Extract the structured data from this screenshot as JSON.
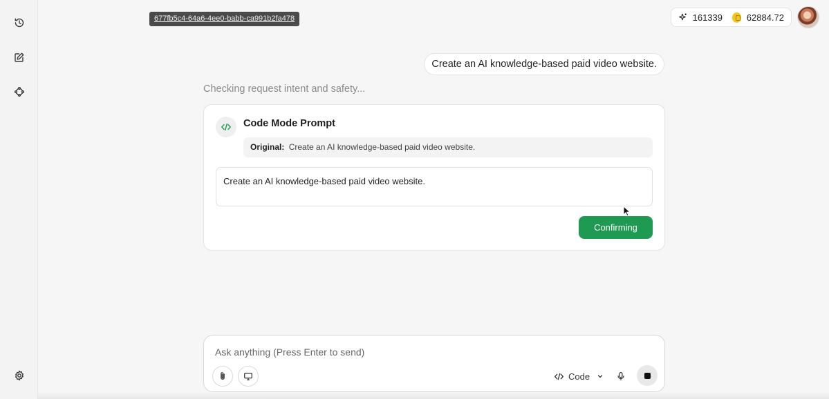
{
  "session": {
    "id": "677fb5c4-64a6-4ee0-babb-ca991b2fa478"
  },
  "stats": {
    "credits": "161339",
    "coins": "62884.72"
  },
  "chat": {
    "user_message": "Create an AI knowledge-based paid video website.",
    "status": "Checking request intent and safety..."
  },
  "card": {
    "title": "Code Mode Prompt",
    "original_label": "Original:",
    "original_text": "Create an AI knowledge-based paid video website.",
    "prompt_value": "Create an AI knowledge-based paid video website.",
    "confirm_label": "Confirming"
  },
  "input": {
    "placeholder": "Ask anything (Press Enter to send)",
    "mode_label": "Code"
  },
  "colors": {
    "accent": "#1f9a52",
    "coin": "#f5c518"
  }
}
